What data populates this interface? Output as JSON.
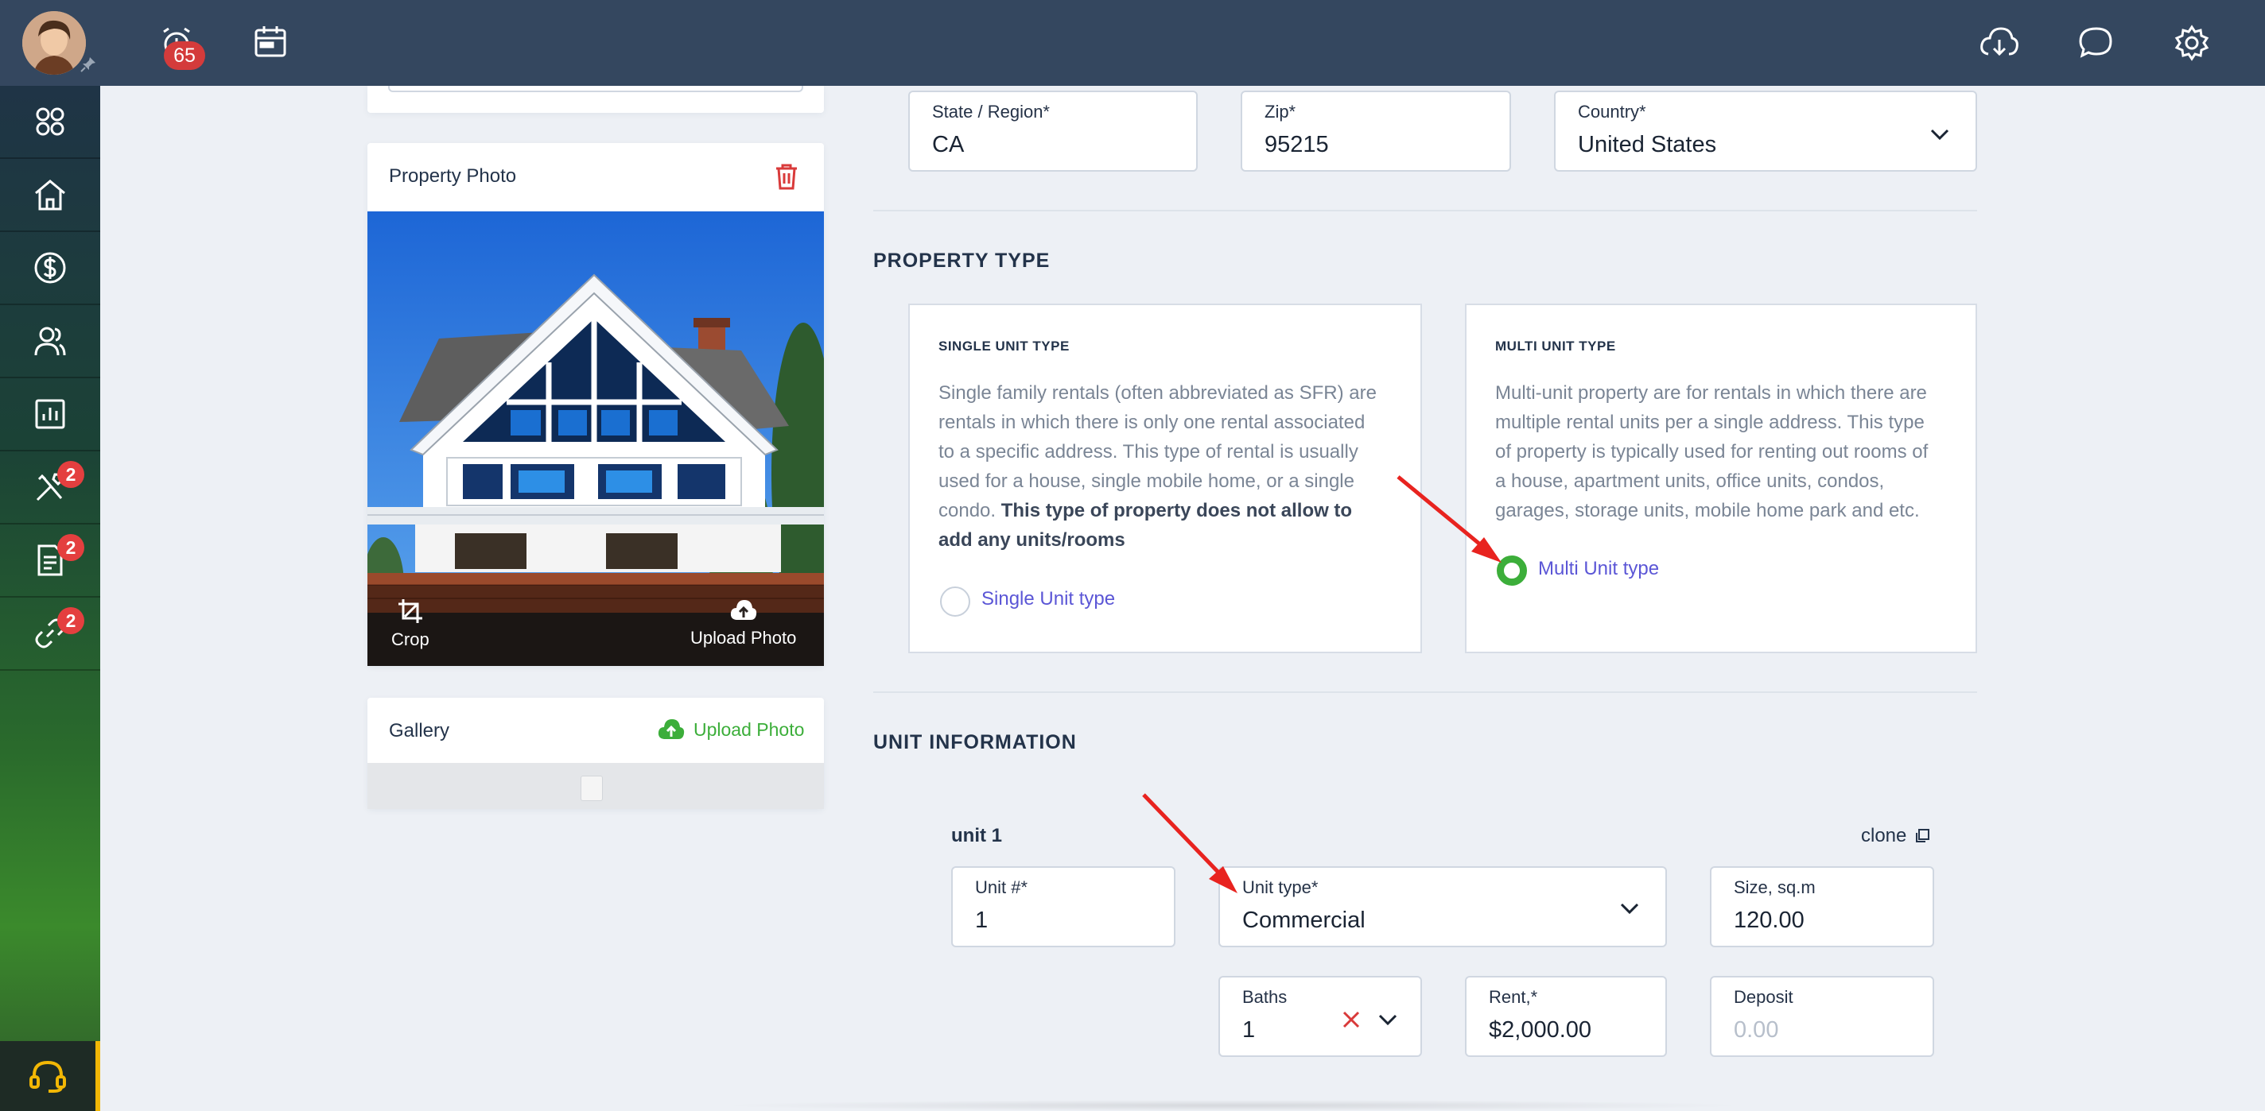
{
  "topbar": {
    "notification_count": "65",
    "icons": [
      "alarm-icon",
      "calendar-icon",
      "cloud-download-icon",
      "chat-icon",
      "gear-icon"
    ]
  },
  "sidebar": {
    "items": [
      {
        "icon": "apps-grid-icon",
        "badge": ""
      },
      {
        "icon": "home-icon",
        "badge": ""
      },
      {
        "icon": "dollar-icon",
        "badge": ""
      },
      {
        "icon": "people-icon",
        "badge": ""
      },
      {
        "icon": "bar-chart-icon",
        "badge": ""
      },
      {
        "icon": "tools-icon",
        "badge": "2"
      },
      {
        "icon": "document-icon",
        "badge": "2"
      },
      {
        "icon": "link-icon",
        "badge": "2"
      }
    ],
    "support_icon": "headset-icon"
  },
  "property_photo": {
    "title": "Property Photo",
    "crop_label": "Crop",
    "upload_label": "Upload Photo"
  },
  "gallery": {
    "title": "Gallery",
    "upload_label": "Upload Photo"
  },
  "address": {
    "state": {
      "label": "State / Region*",
      "value": "CA"
    },
    "zip": {
      "label": "Zip*",
      "value": "95215"
    },
    "country": {
      "label": "Country*",
      "value": "United States"
    }
  },
  "property_type": {
    "section_title": "PROPERTY TYPE",
    "single": {
      "heading": "SINGLE UNIT TYPE",
      "description": "Single family rentals (often abbreviated as SFR) are rentals in which there is only one rental associated to a specific address. This type of rental is usually used for a house, single mobile home, or a single condo.",
      "description_bold": "This type of property does not allow to add any units/rooms",
      "radio_label": "Single Unit type",
      "selected": false
    },
    "multi": {
      "heading": "MULTI UNIT TYPE",
      "description": "Multi-unit property are for rentals in which there are multiple rental units per a single address. This type of property is typically used for renting out rooms of a house, apartment units, office units, condos, garages, storage units, mobile home park and etc.",
      "radio_label": "Multi Unit type",
      "selected": true
    }
  },
  "unit_information": {
    "section_title": "UNIT INFORMATION",
    "unit": {
      "name": "unit 1",
      "clone_label": "clone",
      "unit_number": {
        "label": "Unit #*",
        "value": "1"
      },
      "unit_type": {
        "label": "Unit type*",
        "value": "Commercial"
      },
      "size": {
        "label": "Size, sq.m",
        "value": "120.00"
      },
      "baths": {
        "label": "Baths",
        "value": "1"
      },
      "rent": {
        "label": "Rent,*",
        "value": "$2,000.00"
      },
      "deposit": {
        "label": "Deposit",
        "placeholder": "0.00"
      }
    }
  },
  "colors": {
    "topbar": "#34475f",
    "accent_purple": "#5b56d6",
    "radio_green": "#3cae3a",
    "danger_red": "#d93a3a",
    "annotation_arrow": "#e8231f"
  }
}
